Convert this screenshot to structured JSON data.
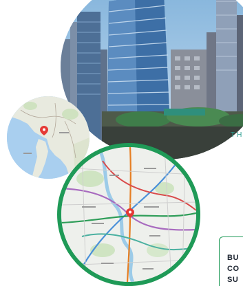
{
  "brand": {
    "letters": "TH"
  },
  "info_box": {
    "line1": "BU",
    "line2": "CO",
    "line3": "SU"
  },
  "colors": {
    "accent_green": "#1f9a57",
    "brand_teal": "#2a9d8f",
    "map_pin_red": "#e53935"
  },
  "icons": {
    "country_pin": "map-pin-icon",
    "city_pin": "map-pin-icon"
  }
}
